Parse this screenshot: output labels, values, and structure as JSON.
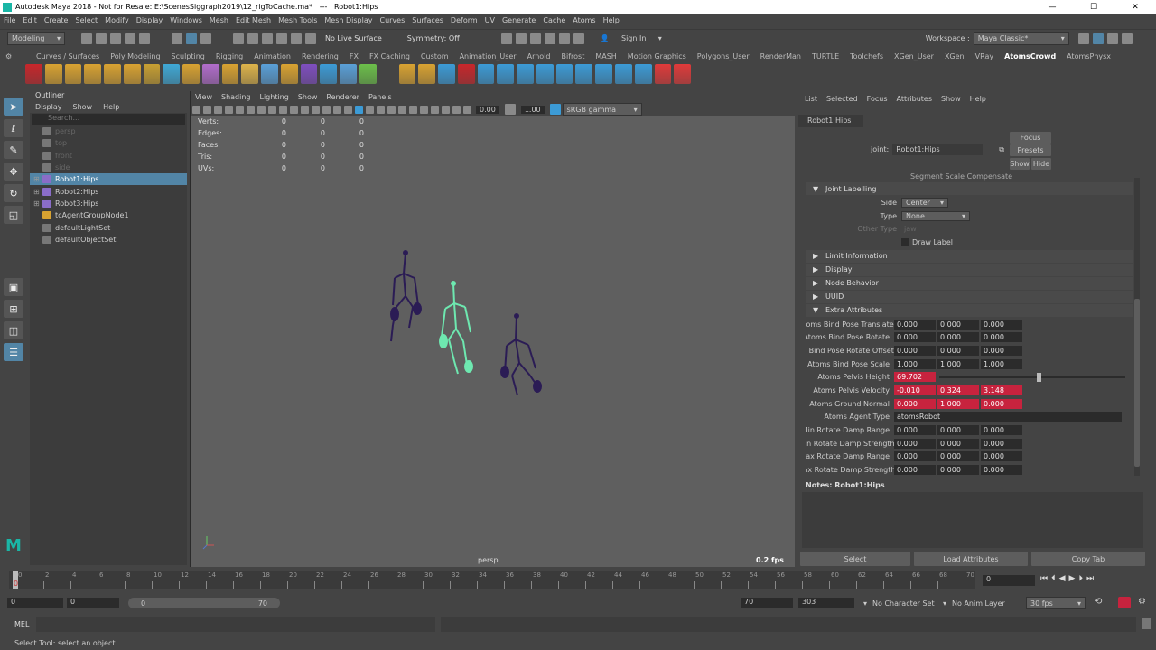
{
  "titlebar": {
    "title": "Autodesk Maya 2018 - Not for Resale: E:\\ScenesSiggraph2019\\12_rigToCache.ma*   ---   Robot1:Hips",
    "min": "—",
    "max": "☐",
    "close": "✕"
  },
  "menubar": [
    "File",
    "Edit",
    "Create",
    "Select",
    "Modify",
    "Display",
    "Windows",
    "Mesh",
    "Edit Mesh",
    "Mesh Tools",
    "Mesh Display",
    "Curves",
    "Surfaces",
    "Deform",
    "UV",
    "Generate",
    "Cache",
    "Atoms",
    "Help"
  ],
  "status": {
    "mode": "Modeling",
    "live_surface": "No Live Surface",
    "symmetry": "Symmetry: Off",
    "sign_in": "Sign In",
    "workspace_label": "Workspace :",
    "workspace": "Maya Classic*"
  },
  "shelf_tabs": [
    "Curves / Surfaces",
    "Poly Modeling",
    "Sculpting",
    "Rigging",
    "Animation",
    "Rendering",
    "FX",
    "FX Caching",
    "Custom",
    "Animation_User",
    "Arnold",
    "Bifrost",
    "MASH",
    "Motion Graphics",
    "Polygons_User",
    "RenderMan",
    "TURTLE",
    "Toolchefs",
    "XGen_User",
    "XGen",
    "VRay",
    "AtomsCrowd",
    "AtomsPhysx"
  ],
  "shelf_active": "AtomsCrowd",
  "shelf_colors": [
    "#c8262b",
    "#d9a331",
    "#d9a331",
    "#d9a331",
    "#d9a331",
    "#d9a331",
    "#c8a032",
    "#3fa9d6",
    "#d9a331",
    "#b26dcc",
    "#d9a331",
    "#ddb34a",
    "#5aa0d8",
    "#d9a331",
    "#7f4ec0",
    "#3c9bd6",
    "#5aa0d8",
    "#6cc04a",
    "#ddd",
    "#d9a331",
    "#d9a331",
    "#3c9bd6",
    "#c8262b",
    "#3c9bd6",
    "#3c9bd6",
    "#3c9bd6",
    "#3c9bd6",
    "#3c9bd6",
    "#3c9bd6",
    "#3c9bd6",
    "#3c9bd6",
    "#3c9bd6",
    "#e03a3a",
    "#e03a3a"
  ],
  "outliner": {
    "title": "Outliner",
    "menu": [
      "Display",
      "Show",
      "Help"
    ],
    "search_placeholder": "Search...",
    "items": [
      {
        "label": "persp",
        "state": "dim",
        "expand": ""
      },
      {
        "label": "top",
        "state": "dim",
        "expand": ""
      },
      {
        "label": "front",
        "state": "dim",
        "expand": ""
      },
      {
        "label": "side",
        "state": "dim",
        "expand": ""
      },
      {
        "label": "Robot1:Hips",
        "state": "sel",
        "expand": "⊞"
      },
      {
        "label": "Robot2:Hips",
        "state": "",
        "expand": "⊞"
      },
      {
        "label": "Robot3:Hips",
        "state": "",
        "expand": "⊞"
      },
      {
        "label": "tcAgentGroupNode1",
        "state": "",
        "expand": ""
      },
      {
        "label": "defaultLightSet",
        "state": "",
        "expand": ""
      },
      {
        "label": "defaultObjectSet",
        "state": "",
        "expand": ""
      }
    ]
  },
  "viewport": {
    "menu": [
      "View",
      "Shading",
      "Lighting",
      "Show",
      "Renderer",
      "Panels"
    ],
    "exposure": "0.00",
    "gamma": "1.00",
    "colorspace": "sRGB gamma",
    "hud": [
      {
        "k": "Verts:",
        "a": "0",
        "b": "0",
        "c": "0"
      },
      {
        "k": "Edges:",
        "a": "0",
        "b": "0",
        "c": "0"
      },
      {
        "k": "Faces:",
        "a": "0",
        "b": "0",
        "c": "0"
      },
      {
        "k": "Tris:",
        "a": "0",
        "b": "0",
        "c": "0"
      },
      {
        "k": "UVs:",
        "a": "0",
        "b": "0",
        "c": "0"
      }
    ],
    "camera": "persp",
    "fps": "0.2 fps"
  },
  "attr": {
    "menu": [
      "List",
      "Selected",
      "Focus",
      "Attributes",
      "Show",
      "Help"
    ],
    "tab": "Robot1:Hips",
    "joint_label": "joint:",
    "joint_value": "Robot1:Hips",
    "focus": "Focus",
    "presets": "Presets",
    "show": "Show",
    "hide": "Hide",
    "cut_row": "Segment Scale Compensate",
    "joint_labelling": "Joint Labelling",
    "side_label": "Side",
    "side_value": "Center",
    "type_label": "Type",
    "type_value": "None",
    "other_type_label": "Other Type",
    "other_type_value": "jaw",
    "draw_label": "Draw Label",
    "sections": [
      "Limit Information",
      "Display",
      "Node Behavior",
      "UUID"
    ],
    "extra": "Extra Attributes",
    "rows": [
      {
        "label": "Atoms Bind Pose Translate",
        "v": [
          "0.000",
          "0.000",
          "0.000"
        ],
        "red": false
      },
      {
        "label": "Atoms Bind Pose Rotate",
        "v": [
          "0.000",
          "0.000",
          "0.000"
        ],
        "red": false
      },
      {
        "label": "as Bind Pose Rotate Offset",
        "v": [
          "0.000",
          "0.000",
          "0.000"
        ],
        "red": false
      },
      {
        "label": "Atoms Bind Pose Scale",
        "v": [
          "1.000",
          "1.000",
          "1.000"
        ],
        "red": false
      },
      {
        "label": "Atoms Pelvis Height",
        "v": [
          "69.702"
        ],
        "red": true,
        "slider": true
      },
      {
        "label": "Atoms Pelvis Velocity",
        "v": [
          "-0.010",
          "0.324",
          "3.148"
        ],
        "red": true
      },
      {
        "label": "Atoms Ground Normal",
        "v": [
          "0.000",
          "1.000",
          "0.000"
        ],
        "red": true
      },
      {
        "label": "Atoms Agent Type",
        "v": [
          "atomsRobot"
        ],
        "red": false,
        "wide": true
      },
      {
        "label": "Min Rotate Damp Range",
        "v": [
          "0.000",
          "0.000",
          "0.000"
        ],
        "red": false
      },
      {
        "label": "vlin Rotate Damp Strength",
        "v": [
          "0.000",
          "0.000",
          "0.000"
        ],
        "red": false
      },
      {
        "label": "Max Rotate Damp Range",
        "v": [
          "0.000",
          "0.000",
          "0.000"
        ],
        "red": false
      },
      {
        "label": "Aax Rotate Damp Strength",
        "v": [
          "0.000",
          "0.000",
          "0.000"
        ],
        "red": false
      }
    ],
    "notes": "Notes:  Robot1:Hips",
    "btn_select": "Select",
    "btn_load": "Load Attributes",
    "btn_copy": "Copy Tab"
  },
  "timeline": {
    "ticks": [
      "0",
      "2",
      "4",
      "6",
      "8",
      "10",
      "12",
      "14",
      "16",
      "18",
      "20",
      "22",
      "24",
      "26",
      "28",
      "30",
      "32",
      "34",
      "36",
      "38",
      "40",
      "42",
      "44",
      "46",
      "48",
      "50",
      "52",
      "54",
      "56",
      "58",
      "60",
      "62",
      "64",
      "66",
      "68",
      "70"
    ],
    "current": "0",
    "frame_field": "0"
  },
  "range": {
    "start": "0",
    "start2": "0",
    "slider_start": "0",
    "slider_end": "70",
    "end": "70",
    "end2": "303",
    "char_set": "No Character Set",
    "anim_layer": "No Anim Layer",
    "fps": "30 fps"
  },
  "cmd": {
    "label": "MEL"
  },
  "help": "Select Tool: select an object"
}
